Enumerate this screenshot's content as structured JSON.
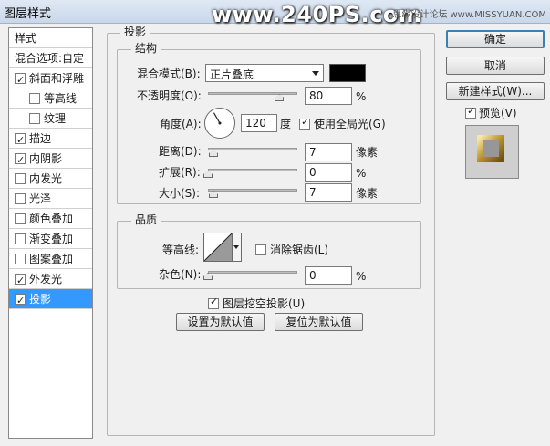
{
  "window": {
    "title": "图层样式"
  },
  "watermark": {
    "text": "www.240PS.com",
    "source": "思缘设计论坛 www.MISSYUAN.COM"
  },
  "styles_panel": {
    "header": "样式",
    "blend_options": "混合选项:自定",
    "items": [
      {
        "label": "斜面和浮雕",
        "checked": true,
        "indent": false,
        "selected": false
      },
      {
        "label": "等高线",
        "checked": false,
        "indent": true,
        "selected": false
      },
      {
        "label": "纹理",
        "checked": false,
        "indent": true,
        "selected": false
      },
      {
        "label": "描边",
        "checked": true,
        "indent": false,
        "selected": false
      },
      {
        "label": "内阴影",
        "checked": true,
        "indent": false,
        "selected": false
      },
      {
        "label": "内发光",
        "checked": false,
        "indent": false,
        "selected": false
      },
      {
        "label": "光泽",
        "checked": false,
        "indent": false,
        "selected": false
      },
      {
        "label": "颜色叠加",
        "checked": false,
        "indent": false,
        "selected": false
      },
      {
        "label": "渐变叠加",
        "checked": false,
        "indent": false,
        "selected": false
      },
      {
        "label": "图案叠加",
        "checked": false,
        "indent": false,
        "selected": false
      },
      {
        "label": "外发光",
        "checked": true,
        "indent": false,
        "selected": false
      },
      {
        "label": "投影",
        "checked": true,
        "indent": false,
        "selected": true
      }
    ]
  },
  "drop_shadow": {
    "section_title": "投影",
    "structure": {
      "title": "结构",
      "blend_mode_label": "混合模式(B):",
      "blend_mode_value": "正片叠底",
      "shadow_color": "#000000",
      "opacity_label": "不透明度(O):",
      "opacity_value": "80",
      "opacity_fraction": 0.8,
      "angle_label": "角度(A):",
      "angle_value": "120",
      "angle_unit": "度",
      "global_light_label": "使用全局光(G)",
      "global_light_checked": true,
      "distance_label": "距离(D):",
      "distance_value": "7",
      "spread_label": "扩展(R):",
      "spread_value": "0",
      "size_label": "大小(S):",
      "size_value": "7",
      "unit_px": "像素",
      "unit_percent": "%"
    },
    "quality": {
      "title": "品质",
      "contour_label": "等高线:",
      "antialias_label": "消除锯齿(L)",
      "antialias_checked": false,
      "noise_label": "杂色(N):",
      "noise_value": "0",
      "unit_percent": "%"
    },
    "knockout_label": "图层挖空投影(U)",
    "knockout_checked": true,
    "set_default_label": "设置为默认值",
    "reset_default_label": "复位为默认值"
  },
  "actions": {
    "ok": "确定",
    "cancel": "取消",
    "new_style": "新建样式(W)...",
    "preview_label": "预览(V)",
    "preview_checked": true
  }
}
